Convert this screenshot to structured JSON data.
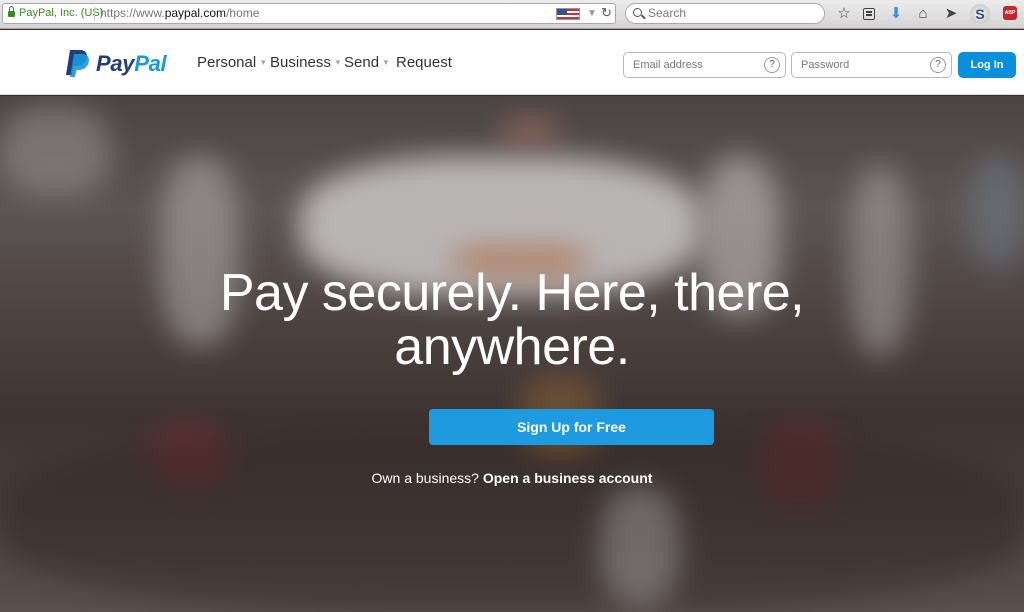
{
  "browser": {
    "identity": "PayPal, Inc. (US)",
    "url_prefix": "https://www.",
    "url_domain": "paypal.com",
    "url_path": "/home",
    "search_placeholder": "Search",
    "toolbar_icons": [
      "star-icon",
      "reading-list-icon",
      "download-icon",
      "home-icon",
      "send-icon",
      "skype-icon",
      "adblock-icon"
    ],
    "s_label": "S",
    "abp_label": "ABP"
  },
  "header": {
    "logo": {
      "part1": "Pay",
      "part2": "Pal",
      "colors": {
        "dark": "#253b80",
        "light": "#179bd7"
      }
    },
    "nav": [
      {
        "label": "Personal",
        "has_dropdown": true
      },
      {
        "label": "Business",
        "has_dropdown": true
      },
      {
        "label": "Send",
        "has_dropdown": true
      },
      {
        "label": "Request",
        "has_dropdown": false
      }
    ],
    "email_placeholder": "Email address",
    "password_placeholder": "Password",
    "help_label": "?",
    "login_label": "Log In",
    "login_color": "#0a8fdc"
  },
  "hero": {
    "headline_line1": "Pay securely. Here, there,",
    "headline_line2": "anywhere.",
    "signup_label": "Sign Up for Free",
    "signup_color": "#1e9be0",
    "business_prompt": "Own a business?",
    "business_link": "Open a business account"
  }
}
